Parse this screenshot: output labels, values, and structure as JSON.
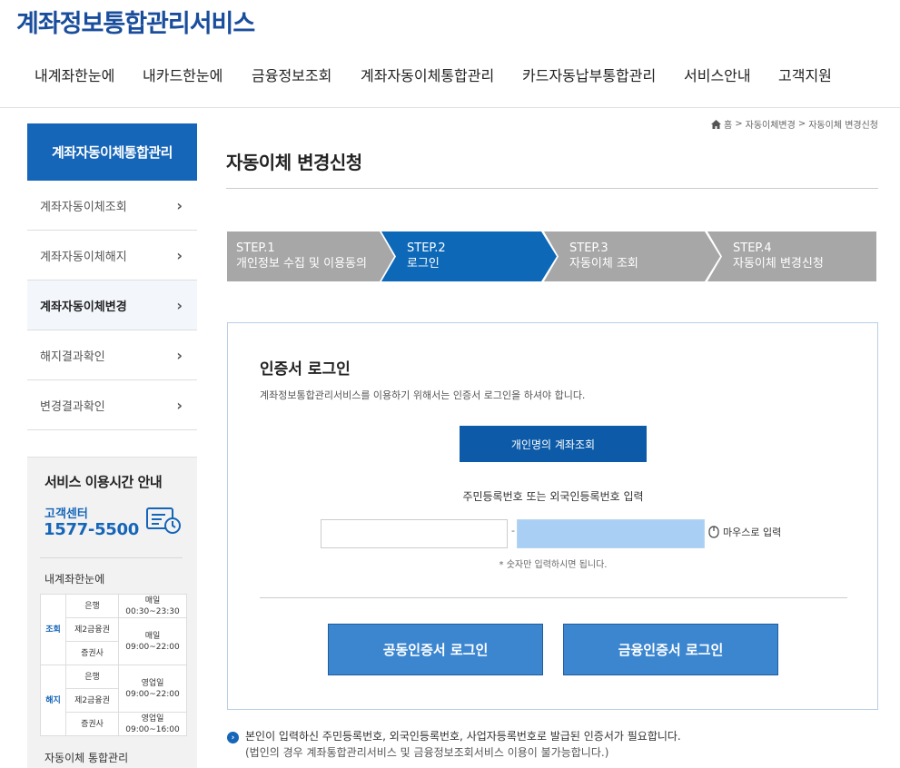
{
  "header": {
    "logo": "계좌정보통합관리서비스",
    "nav": [
      "내계좌한눈에",
      "내카드한눈에",
      "금융정보조회",
      "계좌자동이체통합관리",
      "카드자동납부통합관리",
      "서비스안내",
      "고객지원"
    ]
  },
  "breadcrumb": {
    "home": "홈",
    "sep": ">",
    "level1": "자동이체변경",
    "level2": "자동이체 변경신청"
  },
  "sidebar": {
    "title": "계좌자동이체통합관리",
    "items": [
      {
        "label": "계좌자동이체조회"
      },
      {
        "label": "계좌자동이체해지"
      },
      {
        "label": "계좌자동이체변경",
        "active": true
      },
      {
        "label": "해지결과확인"
      },
      {
        "label": "변경결과확인"
      }
    ],
    "service": {
      "title": "서비스 이용시간 안내",
      "cs_label": "고객센터",
      "phone": "1577-5500",
      "section": "내계좌한눈에",
      "table": {
        "inquiry_label": "조회",
        "cancel_label": "해지",
        "rows": [
          {
            "org": "은행",
            "time_title": "매일",
            "time": "00:30~23:30"
          },
          {
            "org": "제2금융권",
            "time_title": "매일",
            "time": "09:00~22:00"
          },
          {
            "org": "증권사",
            "time_title": "",
            "time": ""
          },
          {
            "org": "은행",
            "time_title": "영업일",
            "time": "09:00~22:00"
          },
          {
            "org": "제2금융권",
            "time_title": "",
            "time": ""
          },
          {
            "org": "증권사",
            "time_title": "영업일",
            "time": "09:00~16:00"
          }
        ]
      },
      "section2": "자동이체 통합관리"
    }
  },
  "main": {
    "title": "자동이체 변경신청",
    "steps": [
      {
        "num": "STEP.1",
        "label": "개인정보 수집 및 이용동의",
        "active": false
      },
      {
        "num": "STEP.2",
        "label": "로그인",
        "active": true
      },
      {
        "num": "STEP.3",
        "label": "자동이체 조회",
        "active": false
      },
      {
        "num": "STEP.4",
        "label": "자동이체 변경신청",
        "active": false
      }
    ],
    "login": {
      "title": "인증서 로그인",
      "desc": "계좌정보통합관리서비스를 이용하기 위해서는 인증서 로그인을 하셔야 합니다.",
      "personal_btn": "개인명의 계좌조회",
      "id_label": "주민등록번호 또는 외국인등록번호 입력",
      "id_front_value": "",
      "id_back_value": "",
      "dash": "-",
      "mouse_input": "마우스로 입력",
      "hint": "* 숫자만 입력하시면 됩니다.",
      "btn_joint": "공동인증서 로그인",
      "btn_financial": "금융인증서 로그인"
    },
    "notice": {
      "line1": "본인이 입력하신 주민등록번호, 외국인등록번호, 사업자등록번호로 발급된 인증서가 필요합니다.",
      "line2": "(법인의 경우 계좌통합관리서비스 및 금융정보조회서비스 이용이 불가능합니다.)"
    }
  },
  "colors": {
    "primary": "#1565b8",
    "step_active": "#0d68b8",
    "step_inactive": "#a7a7a7",
    "button": "#3c86d0",
    "input_highlight": "#a9d0f4"
  }
}
